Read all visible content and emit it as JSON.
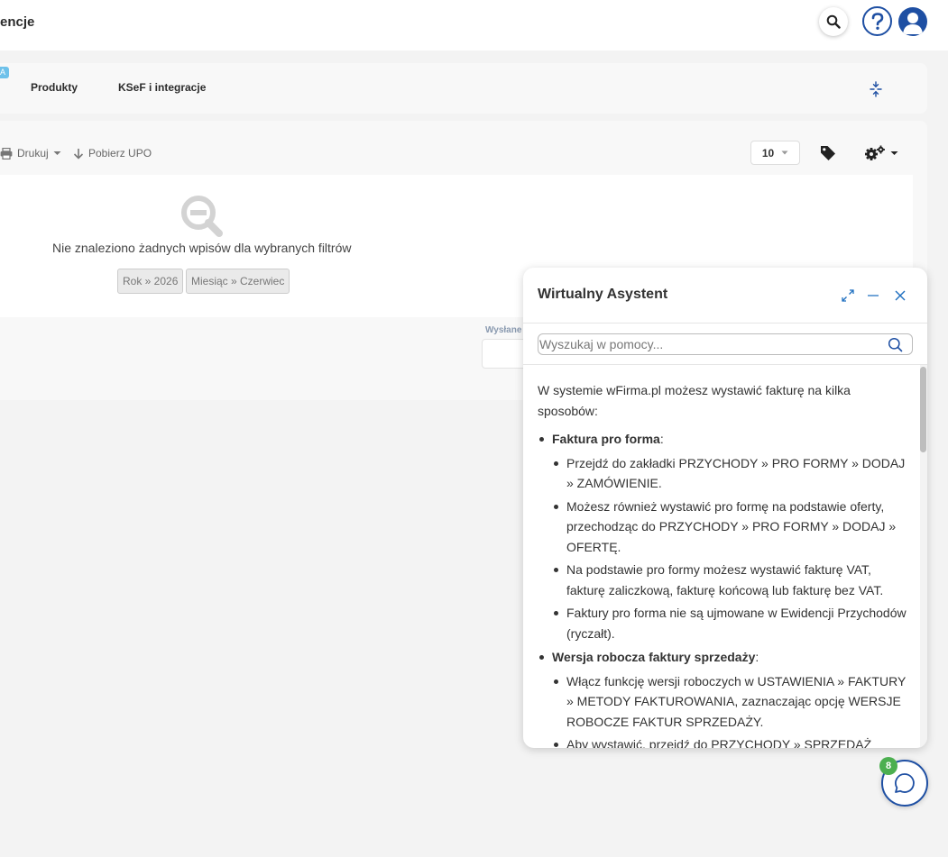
{
  "header": {
    "page_title": "encje"
  },
  "nav": {
    "badge": "A",
    "items": [
      {
        "label": "Produkty"
      },
      {
        "label": "KSeF i integracje"
      }
    ]
  },
  "toolbar": {
    "print_label": "Drukuj",
    "download_label": "Pobierz UPO",
    "per_page_value": "10"
  },
  "empty_state": {
    "message": "Nie znaleziono żadnych wpisów dla wybranych filtrów",
    "filters": [
      {
        "label": "Rok » 2026"
      },
      {
        "label": "Miesiąc » Czerwiec"
      }
    ],
    "sent_label": "Wysłane"
  },
  "assistant": {
    "title": "Wirtualny Asystent",
    "search_placeholder": "Wyszukaj w pomocy...",
    "intro": "W systemie wFirma.pl możesz wystawić fakturę na kilka sposobów:",
    "sections": [
      {
        "heading": "Faktura pro forma",
        "items": [
          "Przejdź do zakładki PRZYCHODY » PRO FORMY » DODAJ » ZAMÓWIENIE.",
          "Możesz również wystawić pro formę na podstawie oferty, przechodząc do PRZYCHODY » PRO FORMY » DODAJ » OFERTĘ.",
          "Na podstawie pro formy możesz wystawić fakturę VAT, fakturę zaliczkową, fakturę końcową lub fakturę bez VAT.",
          "Faktury pro forma nie są ujmowane w Ewidencji Przychodów (ryczałt)."
        ]
      },
      {
        "heading": "Wersja robocza faktury sprzedaży",
        "items": [
          "Włącz funkcję wersji roboczych w USTAWIENIA » FAKTURY » METODY FAKTUROWANIA, zaznaczając opcję WERSJE ROBOCZE FAKTUR SPRZEDAŻY.",
          "Aby wystawić, przejdź do PRZYCHODY » SPRZEDAŻ"
        ]
      }
    ]
  },
  "chat": {
    "badge_count": "8"
  },
  "colors": {
    "brand_blue": "#1e4fa3",
    "badge_green": "#4caf50"
  }
}
